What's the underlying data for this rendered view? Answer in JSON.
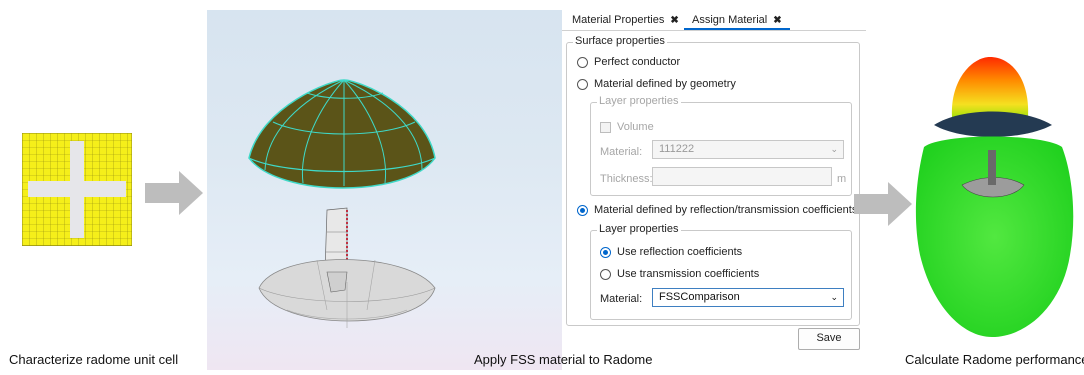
{
  "captions": {
    "left": "Characterize radome unit cell",
    "middle": "Apply FSS material to Radome",
    "right": "Calculate Radome performance"
  },
  "tabs": [
    {
      "label": "Material Properties",
      "close": "✖",
      "active": false
    },
    {
      "label": "Assign Material",
      "close": "✖",
      "active": true
    }
  ],
  "surface": {
    "legend": "Surface properties",
    "option_perfect": "Perfect conductor",
    "option_geometry": "Material defined by geometry",
    "option_coefficients": "Material defined by reflection/transmission coefficients",
    "selected": "Material defined by reflection/transmission coefficients"
  },
  "layer_disabled": {
    "legend": "Layer properties",
    "volume_label": "Volume",
    "material_label": "Material:",
    "material_value": "111222",
    "thickness_label": "Thickness:",
    "thickness_value": "",
    "thickness_unit": "m"
  },
  "layer_active": {
    "legend": "Layer properties",
    "option_reflection": "Use reflection coefficients",
    "option_transmission": "Use transmission coefficients",
    "selected": "Use reflection coefficients",
    "material_label": "Material:",
    "material_value": "FSSComparison"
  },
  "save_label": "Save",
  "colors": {
    "unit_cell": "#f5ef1a",
    "radome_dome": "#5b5418",
    "dome_lines": "#3fd9c8",
    "arrow": "#bdbdbd",
    "accent": "#0066cc"
  }
}
